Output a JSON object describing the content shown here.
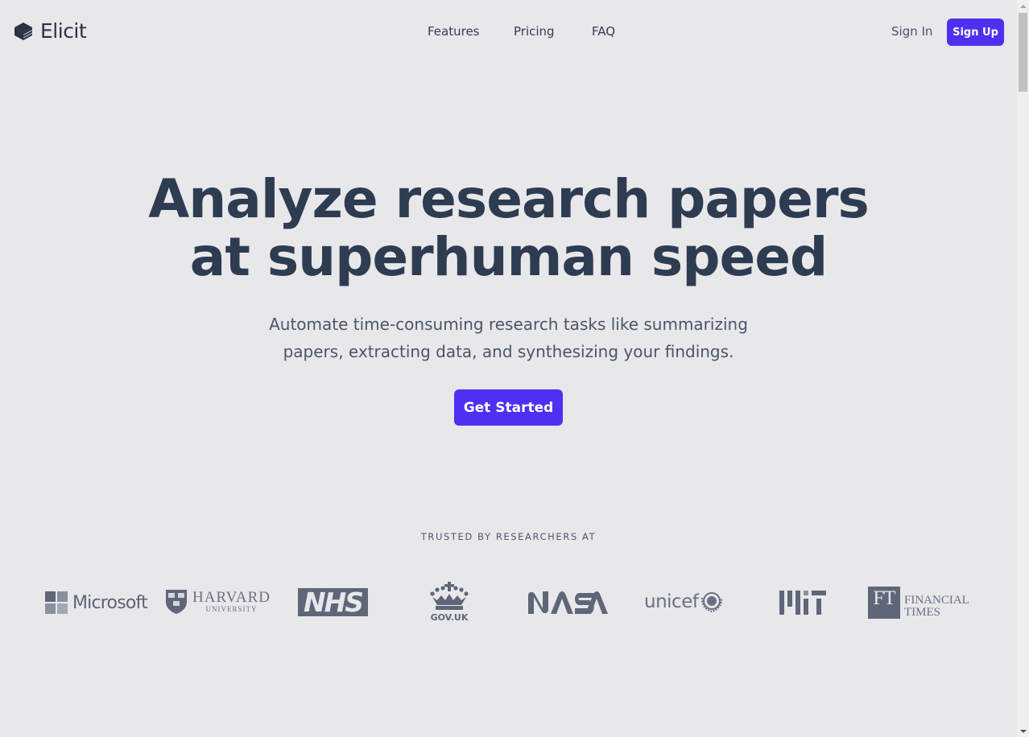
{
  "header": {
    "brand": "Elicit",
    "nav": [
      "Features",
      "Pricing",
      "FAQ"
    ],
    "sign_in": "Sign In",
    "sign_up": "Sign Up"
  },
  "hero": {
    "title_line1": "Analyze research papers",
    "title_line2": "at superhuman speed",
    "subtitle_line1": "Automate time-consuming research tasks like summarizing",
    "subtitle_line2": "papers, extracting data, and synthesizing your findings.",
    "cta": "Get Started"
  },
  "trusted": {
    "heading": "TRUSTED BY RESEARCHERS AT",
    "logos": [
      {
        "name": "Microsoft",
        "text": "Microsoft"
      },
      {
        "name": "Harvard University",
        "text": "HARVARD",
        "subtext": "UNIVERSITY"
      },
      {
        "name": "NHS",
        "text": "NHS"
      },
      {
        "name": "GOV.UK",
        "text": "GOV.UK"
      },
      {
        "name": "NASA",
        "text": "NASA"
      },
      {
        "name": "UNICEF",
        "text": "unicef"
      },
      {
        "name": "MIT",
        "text": "MIT"
      },
      {
        "name": "Financial Times",
        "box": "FT",
        "text": "FINANCIAL",
        "subtext": "TIMES"
      }
    ]
  },
  "colors": {
    "background": "#e8e8eb",
    "accent": "#4f2ff2",
    "heading": "#2e3c52",
    "logo_gray": "#5f6678"
  }
}
